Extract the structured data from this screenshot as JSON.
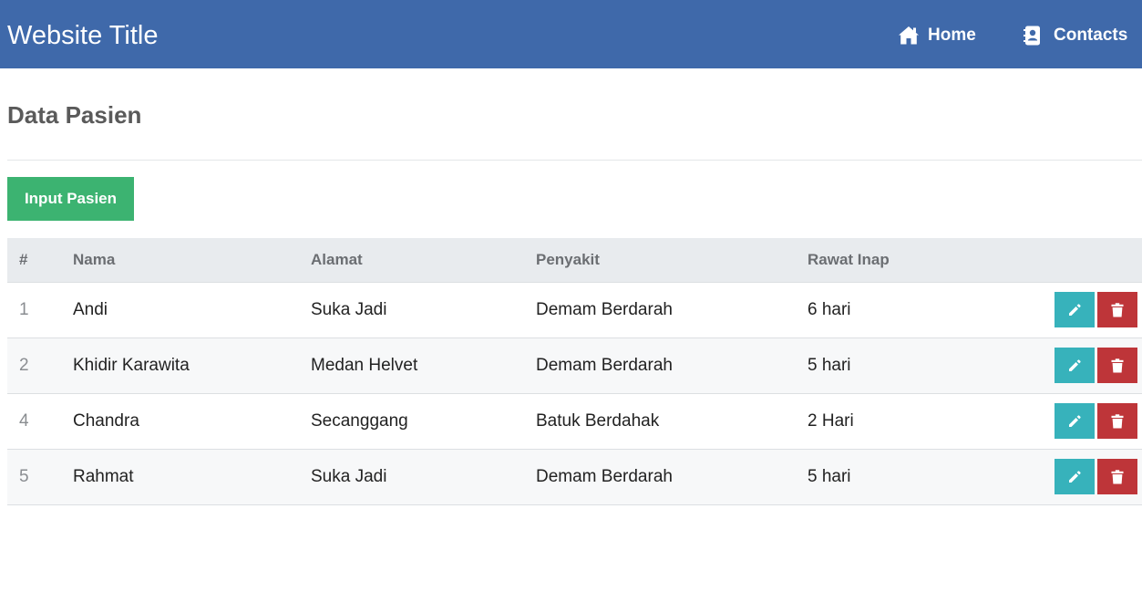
{
  "navbar": {
    "brand": "Website Title",
    "links": [
      {
        "label": "Home",
        "icon": "home-icon"
      },
      {
        "label": "Contacts",
        "icon": "address-book-icon"
      }
    ],
    "background": "#3f69aa"
  },
  "page": {
    "title": "Data Pasien",
    "add_button_label": "Input Pasien"
  },
  "table": {
    "headers": [
      "#",
      "Nama",
      "Alamat",
      "Penyakit",
      "Rawat Inap"
    ],
    "rows": [
      {
        "no": "1",
        "nama": "Andi",
        "alamat": "Suka Jadi",
        "penyakit": "Demam Berdarah",
        "rawat_inap": "6 hari"
      },
      {
        "no": "2",
        "nama": "Khidir Karawita",
        "alamat": "Medan Helvet",
        "penyakit": "Demam Berdarah",
        "rawat_inap": "5 hari"
      },
      {
        "no": "4",
        "nama": "Chandra",
        "alamat": "Secanggang",
        "penyakit": "Batuk Berdahak",
        "rawat_inap": "2 Hari"
      },
      {
        "no": "5",
        "nama": "Rahmat",
        "alamat": "Suka Jadi",
        "penyakit": "Demam Berdarah",
        "rawat_inap": "5 hari"
      }
    ],
    "row_actions": [
      {
        "icon": "pencil-icon",
        "color": "#37b2bb"
      },
      {
        "icon": "trash-icon",
        "color": "#be3539"
      }
    ]
  },
  "colors": {
    "accent_green": "#3cb371",
    "edit_teal": "#37b2bb",
    "delete_red": "#be3539"
  }
}
